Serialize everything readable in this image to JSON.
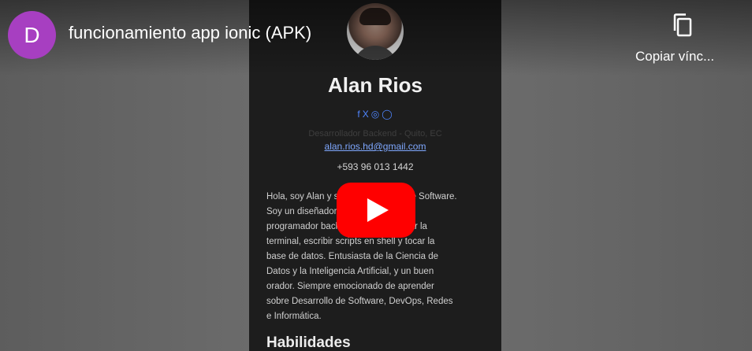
{
  "player": {
    "channel_initial": "D",
    "title": "funcionamiento app ionic (APK)",
    "copy_label": "Copiar vínc..."
  },
  "profile": {
    "name": "Alan Rios",
    "social_icons": [
      "facebook-icon",
      "x-icon",
      "instagram-icon",
      "github-icon"
    ],
    "social_glyphs": [
      "f",
      "X",
      "◎",
      "◯"
    ],
    "role": "Desarrollador Backend - Quito, EC",
    "email": "alan.rios.hd@gmail.com",
    "phone": "+593 96 013 1442",
    "bio_lines": [
      "Hola, soy Alan y soy desarrollador de Software.",
      "Soy un diseñador web eficiente,",
      "programador backend que gusta usar la",
      "terminal, escribir scripts en shell y tocar la",
      "base de datos. Entusiasta de la Ciencia de",
      "Datos y la Inteligencia Artificial, y un buen",
      "orador. Siempre emocionado de aprender",
      "sobre Desarrollo de Software, DevOps, Redes",
      "e Informática."
    ],
    "section_title": "Habilidades"
  },
  "colors": {
    "channel_avatar": "#a73fc1",
    "play_button": "#ff0000",
    "link": "#4f86ff"
  }
}
